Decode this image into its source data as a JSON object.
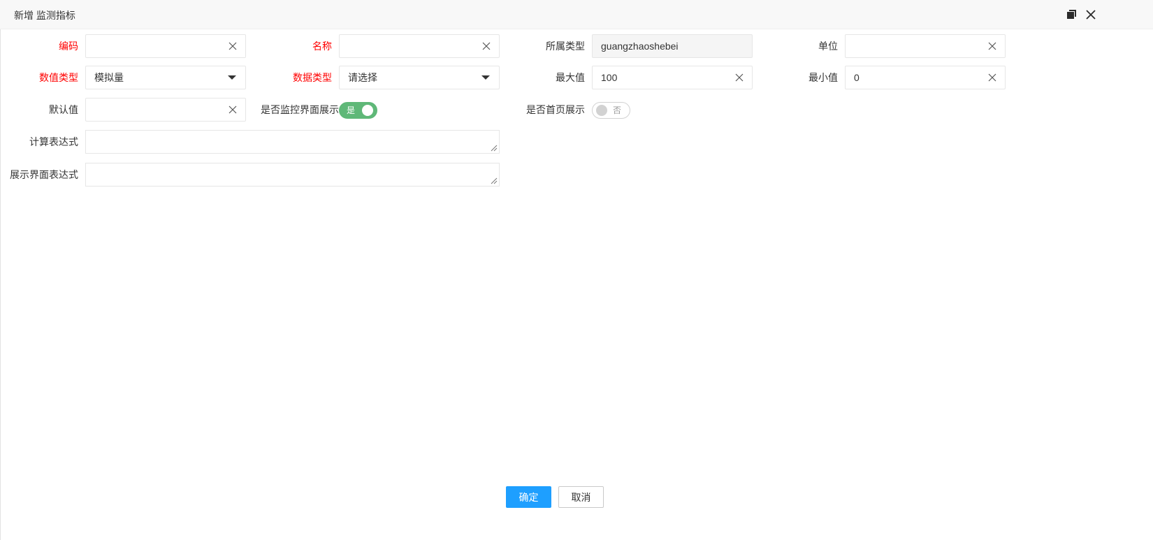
{
  "dialog": {
    "title": "新增 监测指标"
  },
  "form": {
    "code": {
      "label": "编码",
      "value": ""
    },
    "name": {
      "label": "名称",
      "value": ""
    },
    "category": {
      "label": "所属类型",
      "value": "guangzhaoshebei"
    },
    "unit": {
      "label": "单位",
      "value": ""
    },
    "value_type": {
      "label": "数值类型",
      "selected": "模拟量"
    },
    "data_type": {
      "label": "数据类型",
      "selected": "请选择"
    },
    "max": {
      "label": "最大值",
      "value": "100"
    },
    "min": {
      "label": "最小值",
      "value": "0"
    },
    "default": {
      "label": "默认值",
      "value": ""
    },
    "show_monitor": {
      "label": "是否监控界面展示",
      "state_text": "是",
      "on": true
    },
    "show_home": {
      "label": "是否首页展示",
      "state_text": "否",
      "on": false
    },
    "calc_expr": {
      "label": "计算表达式",
      "value": ""
    },
    "display_expr": {
      "label": "展示界面表达式",
      "value": ""
    }
  },
  "actions": {
    "confirm": "确定",
    "cancel": "取消"
  },
  "colors": {
    "required_label": "#ff0000",
    "primary_button": "#1e9fff",
    "switch_on": "#5fb878"
  },
  "icons": {
    "clear": "close-x-icon",
    "dropdown": "triangle-down-icon",
    "maximize": "restore-window-icon",
    "close": "close-icon"
  }
}
